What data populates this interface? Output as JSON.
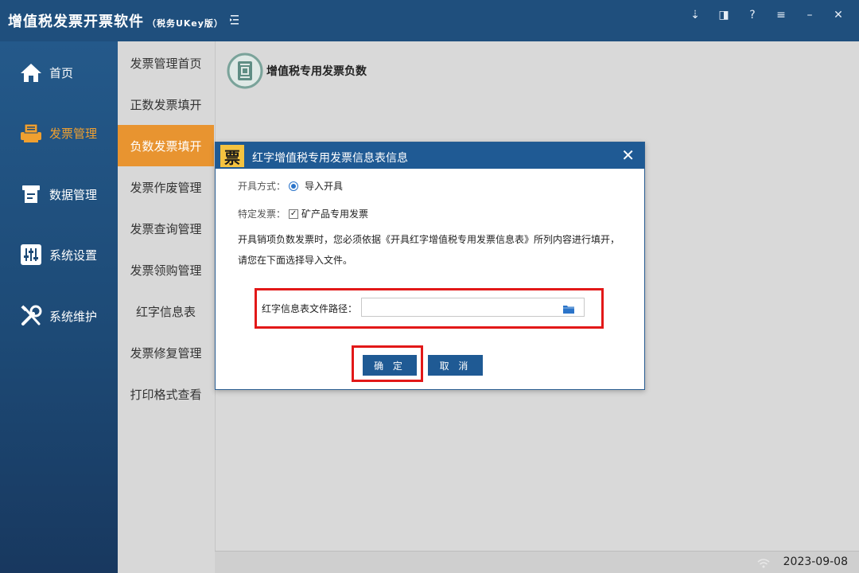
{
  "app": {
    "title": "增值税发票开票软件",
    "subtitle": "（税务UKey版）"
  },
  "top_icons": [
    "download-icon",
    "bookmark-icon",
    "help-icon",
    "menu-icon",
    "minimize-icon",
    "close-icon"
  ],
  "top_icon_glyphs": [
    "⇣",
    "◨",
    "?",
    "≡",
    "–",
    "✕"
  ],
  "nav": [
    {
      "label": "首页",
      "icon": "home-icon"
    },
    {
      "label": "发票管理",
      "icon": "invoice-printer-icon",
      "active": true
    },
    {
      "label": "数据管理",
      "icon": "data-icon"
    },
    {
      "label": "系统设置",
      "icon": "settings-sliders-icon"
    },
    {
      "label": "系统维护",
      "icon": "tools-icon"
    }
  ],
  "subnav": [
    {
      "label": "发票管理首页"
    },
    {
      "label": "正数发票填开"
    },
    {
      "label": "负数发票填开",
      "active": true
    },
    {
      "label": "发票作废管理"
    },
    {
      "label": "发票查询管理"
    },
    {
      "label": "发票领购管理"
    },
    {
      "label": "红字信息表"
    },
    {
      "label": "发票修复管理"
    },
    {
      "label": "打印格式查看"
    }
  ],
  "main": {
    "header_title": "增值税专用发票负数"
  },
  "dialog": {
    "icon_glyph": "票",
    "title": "红字增值税专用发票信息表信息",
    "close_glyph": "✕",
    "mode_label": "开具方式：",
    "mode_value": "导入开具",
    "special_label": "特定发票：",
    "special_check": "✓",
    "special_value": "矿产品专用发票",
    "description": "开具销项负数发票时，您必须依据《开具红字增值税专用发票信息表》所列内容进行填开，请您在下面选择导入文件。",
    "path_label": "红字信息表文件路径：",
    "path_value": "",
    "ok_label": "确定",
    "cancel_label": "取消"
  },
  "status": {
    "date": "2023-09-08"
  },
  "colors": {
    "brand_blue": "#1f5a94",
    "active_orange": "#e89430",
    "highlight_red": "#e21818"
  }
}
